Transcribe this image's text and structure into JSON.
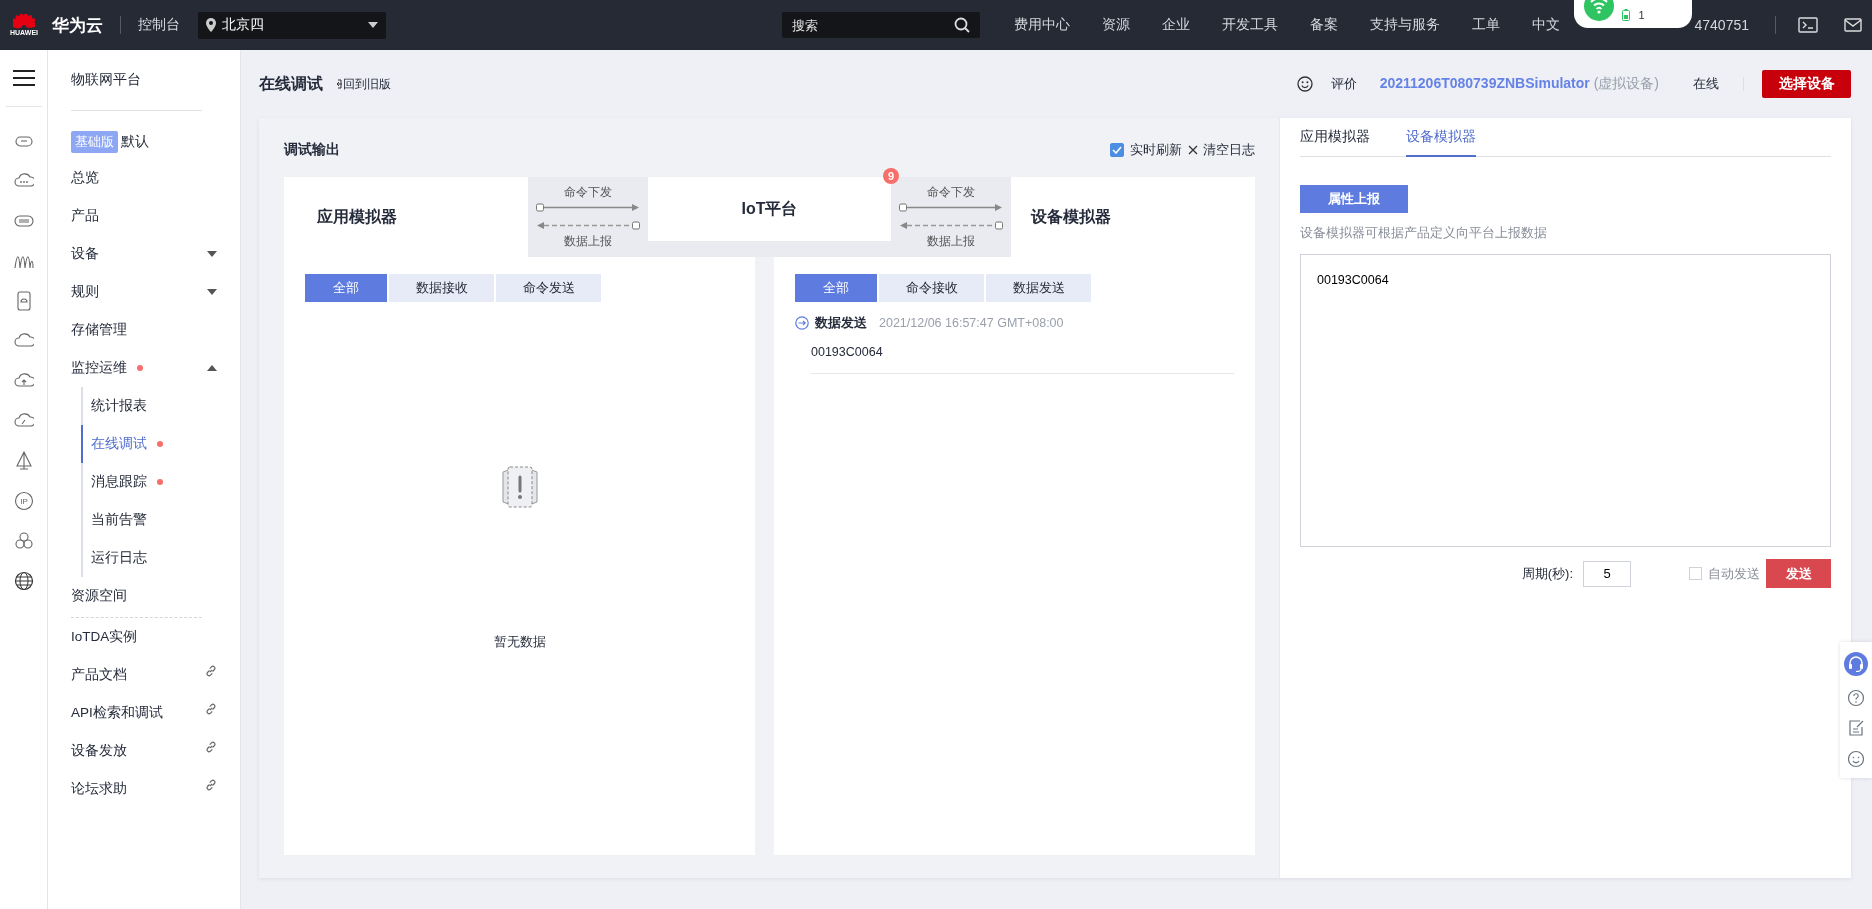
{
  "topbar": {
    "logo_text": "HUAWEI",
    "brand": "华为云",
    "console": "控制台",
    "region": "北京四",
    "search": {
      "placeholder": "搜索"
    },
    "nav": [
      "费用中心",
      "资源",
      "企业",
      "开发工具",
      "备案",
      "支持与服务",
      "工单",
      "中文"
    ],
    "popup": {
      "count": "1"
    },
    "account": "4740751"
  },
  "icon_rail": {
    "ip_label": "IP"
  },
  "sidebar": {
    "title": "物联网平台",
    "edition": {
      "badge": "基础版",
      "label": "默认"
    },
    "items": [
      {
        "label": "总览",
        "kind": "item",
        "alert": false
      },
      {
        "label": "产品",
        "kind": "item",
        "alert": false
      },
      {
        "label": "设备",
        "kind": "group",
        "expanded": false,
        "alert": false
      },
      {
        "label": "规则",
        "kind": "group",
        "expanded": false,
        "alert": false
      },
      {
        "label": "存储管理",
        "kind": "item",
        "alert": false
      },
      {
        "label": "监控运维",
        "kind": "group",
        "expanded": true,
        "alert": true,
        "children": [
          {
            "label": "统计报表",
            "selected": false,
            "alert": false
          },
          {
            "label": "在线调试",
            "selected": true,
            "alert": true
          },
          {
            "label": "消息跟踪",
            "selected": false,
            "alert": true
          },
          {
            "label": "当前告警",
            "selected": false,
            "alert": false
          },
          {
            "label": "运行日志",
            "selected": false,
            "alert": false
          }
        ]
      },
      {
        "label": "资源空间",
        "kind": "item",
        "alert": false
      }
    ],
    "resources": [
      {
        "label": "IoTDA实例",
        "kind": "item"
      },
      {
        "label": "产品文档",
        "kind": "link"
      },
      {
        "label": "API检索和调试",
        "kind": "link"
      },
      {
        "label": "设备发放",
        "kind": "link"
      },
      {
        "label": "论坛求助",
        "kind": "link"
      }
    ]
  },
  "page": {
    "title": "在线调试",
    "back_link": "回到旧版",
    "rating": "评价",
    "device": {
      "name": "20211206T080739ZNBSimulator",
      "tag": "(虚拟设备)"
    },
    "status": "在线",
    "select_button": "选择设备"
  },
  "debug": {
    "title": "调试输出",
    "realtime": {
      "label": "实时刷新",
      "checked": true
    },
    "clear": "清空日志",
    "diagram": {
      "app": "应用模拟器",
      "platform": "IoT平台",
      "badge": "9",
      "device": "设备模拟器",
      "links": [
        {
          "down": "命令下发",
          "up": "数据上报"
        },
        {
          "down": "命令下发",
          "up": "数据上报"
        }
      ]
    },
    "app_panel": {
      "tabs": [
        {
          "label": "全部",
          "selected": true
        },
        {
          "label": "数据接收",
          "selected": false
        },
        {
          "label": "命令发送",
          "selected": false
        }
      ],
      "empty": "暂无数据"
    },
    "device_panel": {
      "tabs": [
        {
          "label": "全部",
          "selected": true
        },
        {
          "label": "命令接收",
          "selected": false
        },
        {
          "label": "数据发送",
          "selected": false
        }
      ],
      "messages": [
        {
          "type": "数据发送",
          "time": "2021/12/06 16:57:47 GMT+08:00",
          "body": "00193C0064"
        }
      ]
    }
  },
  "simulator": {
    "tabs": [
      {
        "label": "应用模拟器",
        "selected": false
      },
      {
        "label": "设备模拟器",
        "selected": true
      }
    ],
    "report_button": "属性上报",
    "hint": "设备模拟器可根据产品定义向平台上报数据",
    "payload": "00193C0064",
    "period_label": "周期(秒):",
    "period": "5",
    "auto_send": {
      "label": "自动发送",
      "checked": false
    },
    "send": "发送"
  }
}
